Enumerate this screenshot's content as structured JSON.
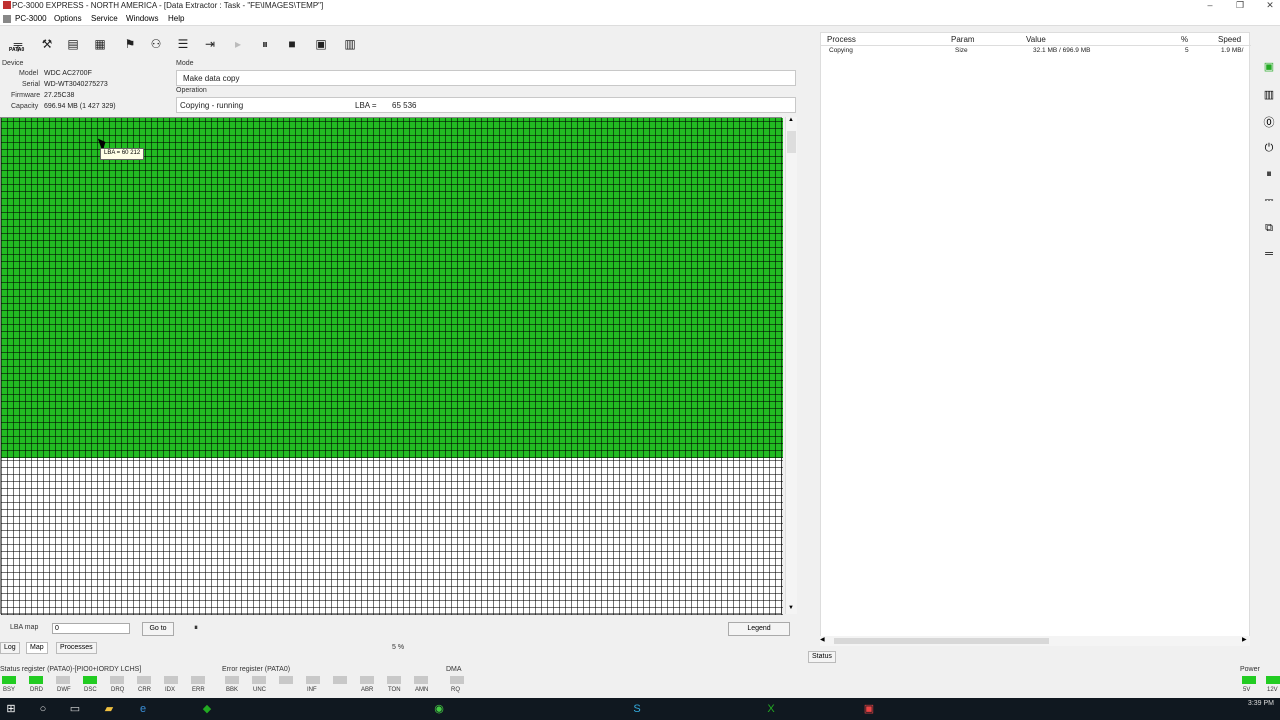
{
  "window": {
    "title": "PC-3000 EXPRESS - NORTH AMERICA - [Data Extractor : Task - \"FE\\IMAGES\\TEMP\"]"
  },
  "menu": [
    "PC-3000",
    "Options",
    "Service",
    "Windows",
    "Help"
  ],
  "toolbar": {
    "port_label": "PATA0"
  },
  "device": {
    "section": "Device",
    "model_label": "Model",
    "model": "WDC AC2700F",
    "serial_label": "Serial",
    "serial": "WD-WT3040275273",
    "firmware_label": "Firmware",
    "firmware": "27.25C38",
    "capacity_label": "Capacity",
    "capacity": "696.94 MB (1 427 329)"
  },
  "mode": {
    "section": "Mode",
    "value": "Make data copy"
  },
  "operation": {
    "section": "Operation",
    "status": "Copying - running",
    "lba_label": "LBA =",
    "lba": "65 536"
  },
  "tooltip": "LBA = 60 212",
  "process_table": {
    "headers": [
      "Process",
      "Param",
      "Value",
      "%",
      "Speed"
    ],
    "rows": [
      [
        "Copying",
        "Size",
        "32.1 MB / 696.9 MB",
        "5",
        "1.9 MB/"
      ]
    ]
  },
  "lba_map": {
    "label": "LBA map",
    "input": "0",
    "goto": "Go to",
    "legend": "Legend",
    "progress": "5 %"
  },
  "tabs": [
    "Log",
    "Map",
    "Processes"
  ],
  "right_tabs": [
    "Status"
  ],
  "status_register": {
    "title": "Status register (PATA0)-[PIO0+IORDY LCHS]",
    "flags": [
      "BSY",
      "DRD",
      "DWF",
      "DSC",
      "DRQ",
      "CRR",
      "IDX",
      "ERR"
    ],
    "on": [
      true,
      true,
      false,
      true,
      false,
      false,
      false,
      false
    ]
  },
  "error_register": {
    "title": "Error register (PATA0)",
    "flags": [
      "BBK",
      "UNC",
      "",
      "INF",
      "",
      "ABR",
      "TON",
      "AMN"
    ]
  },
  "dma": {
    "title": "DMA",
    "flags": [
      "RQ"
    ]
  },
  "power": {
    "title": "Power",
    "flags": [
      "5V",
      "12V"
    ]
  },
  "clock": {
    "time": "3:39 PM"
  }
}
